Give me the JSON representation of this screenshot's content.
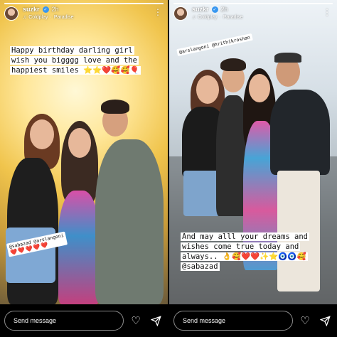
{
  "stories": [
    {
      "progress_fraction": 1.0,
      "username": "suzkr",
      "time": "2h",
      "music": {
        "artist": "Coldplay",
        "song": "Paradise"
      },
      "caption_lines": [
        "Happy birthday darling girl",
        "wish you bigggg love and the",
        "happiest smiles ⭐⭐❤️🥰🥰🎈"
      ],
      "tags": [
        "@sabazad @arslangoni",
        "❤️❤️❤️❤️❤️"
      ]
    },
    {
      "progress_fraction": 1.0,
      "username": "suzkr",
      "time": "2h",
      "music": {
        "artist": "Coldplay",
        "song": "Paradise"
      },
      "mention_sticker": "@arslangoni @hrithikroshan",
      "caption_lines": [
        "And may alll your dreams and",
        "wishes come true today and",
        "always.. 👌🥰❤️❤️✨⭐🧿🧿🥰",
        "@sabazad"
      ]
    }
  ],
  "bottom_bar": {
    "message_placeholder": "Send message"
  },
  "icons": {
    "more": "more-vertical-icon",
    "like": "heart-icon",
    "send": "paper-plane-icon",
    "music": "music-note-icon",
    "verified": "verified-badge-icon"
  }
}
